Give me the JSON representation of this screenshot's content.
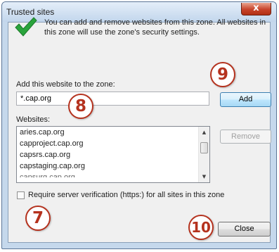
{
  "window": {
    "title": "Trusted sites",
    "close_glyph": "x"
  },
  "info": {
    "icon": "green-checkmark-icon",
    "text": "You can add and remove websites from this zone. All websites in this zone will use the zone's security settings."
  },
  "add_site": {
    "label": "Add this website to the zone:",
    "value": "*.cap.org",
    "button_label": "Add"
  },
  "websites": {
    "label": "Websites:",
    "items": [
      "aries.cap.org",
      "capproject.cap.org",
      "capsrs.cap.org",
      "capstaging.cap.org",
      "capsurg.cap.org"
    ],
    "remove_label": "Remove"
  },
  "verification": {
    "label": "Require server verification (https:) for all sites in this zone",
    "checked": false
  },
  "close_label": "Close",
  "annotations": [
    "7",
    "8",
    "9",
    "10"
  ],
  "colors": {
    "badge": "#b5321e",
    "checkmark": "#2aa43c",
    "title_close": "#c7432a"
  }
}
